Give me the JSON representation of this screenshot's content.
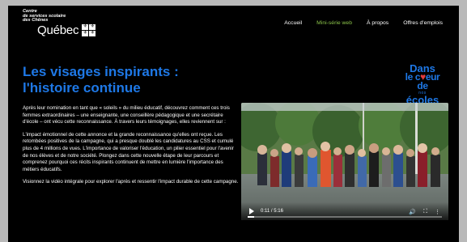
{
  "logo": {
    "small_line1": "Centre",
    "small_line2": "de services scolaire",
    "small_line3": "des Chênes",
    "quebec": "Québec"
  },
  "nav": {
    "items": [
      {
        "label": "Accueil"
      },
      {
        "label": "Mini-série web"
      },
      {
        "label": "À propos"
      },
      {
        "label": "Offres d'emplois"
      }
    ],
    "active_index": 1
  },
  "main": {
    "heading_line1": "Les visages inspirants :",
    "heading_line2": "l'histoire continue",
    "paragraphs": [
      "Après leur nomination en tant que « soleils » du milieu éducatif, découvrez comment ces trois femmes extraordinaires – une enseignante, une conseillère pédagogique et une secrétaire d'école – ont vécu cette reconnaissance. À travers leurs témoignages, elles reviennent sur :",
      "L'impact émotionnel de cette annonce et la grande reconnaissance qu'elles ont reçue. Les retombées positives de la campagne, qui a presque doublé les candidatures au CSS et cumulé plus de 4 millions de vues. L'importance de valoriser l'éducation, un pilier essentiel pour l'avenir de nos élèves et de notre société. Plongez dans cette nouvelle étape de leur parcours et comprenez pourquoi ces récits inspirants continuent de mettre en lumière l'importance des métiers éducatifs.",
      "Visionnez la vidéo intégrale pour explorer l'après et ressentir l'impact durable de cette campagne."
    ]
  },
  "brand": {
    "line1": "Dans",
    "line2a": "le c",
    "line2b": "eur de",
    "line3": "nos",
    "line4": "écoles"
  },
  "video": {
    "time": "0:11 / 5:16",
    "progress": 0.035
  },
  "colors": {
    "accent_blue": "#1e78e6",
    "active_nav_green": "#8bc34a",
    "background": "#000000"
  }
}
